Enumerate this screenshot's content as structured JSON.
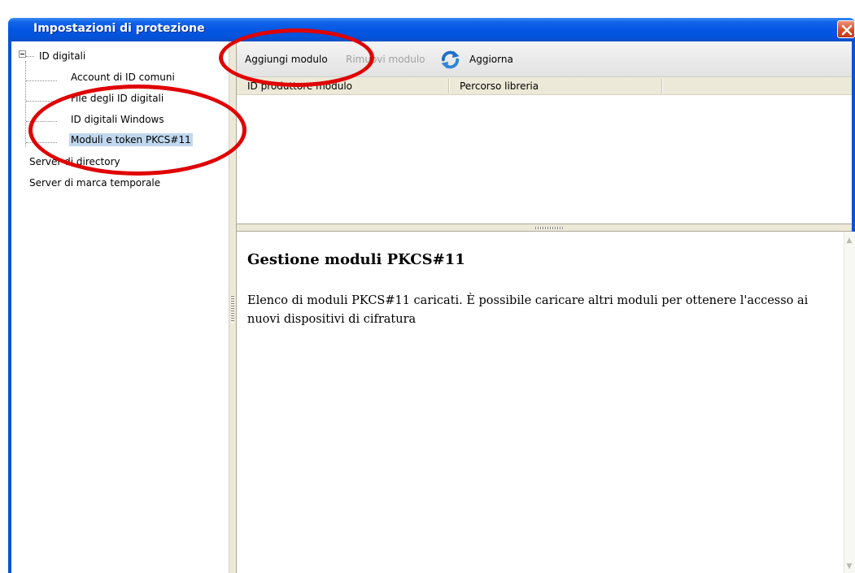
{
  "window": {
    "title": "Impostazioni di protezione"
  },
  "tree": {
    "items": [
      {
        "label": "ID digitali"
      },
      {
        "label": "Account di ID comuni"
      },
      {
        "label": "File degli ID digitali"
      },
      {
        "label": "ID digitali Windows"
      },
      {
        "label": "Moduli e token PKCS#11"
      },
      {
        "label": "Server di directory"
      },
      {
        "label": "Server di marca temporale"
      }
    ]
  },
  "toolbar": {
    "add_label": "Aggiungi modulo",
    "remove_label": "Rimuovi modulo",
    "refresh_label": "Aggiorna"
  },
  "list": {
    "columns": [
      "ID produttore modulo",
      "Percorso libreria"
    ]
  },
  "description": {
    "title": "Gestione moduli PKCS#11",
    "text": "Elenco di moduli PKCS#11 caricati. È possibile caricare altri moduli per ottenere l'accesso ai nuovi dispositivi di cifratura"
  },
  "colors": {
    "titlebar": "#0457e3",
    "selection": "#c0d8ee",
    "annotation": "#e00000"
  }
}
